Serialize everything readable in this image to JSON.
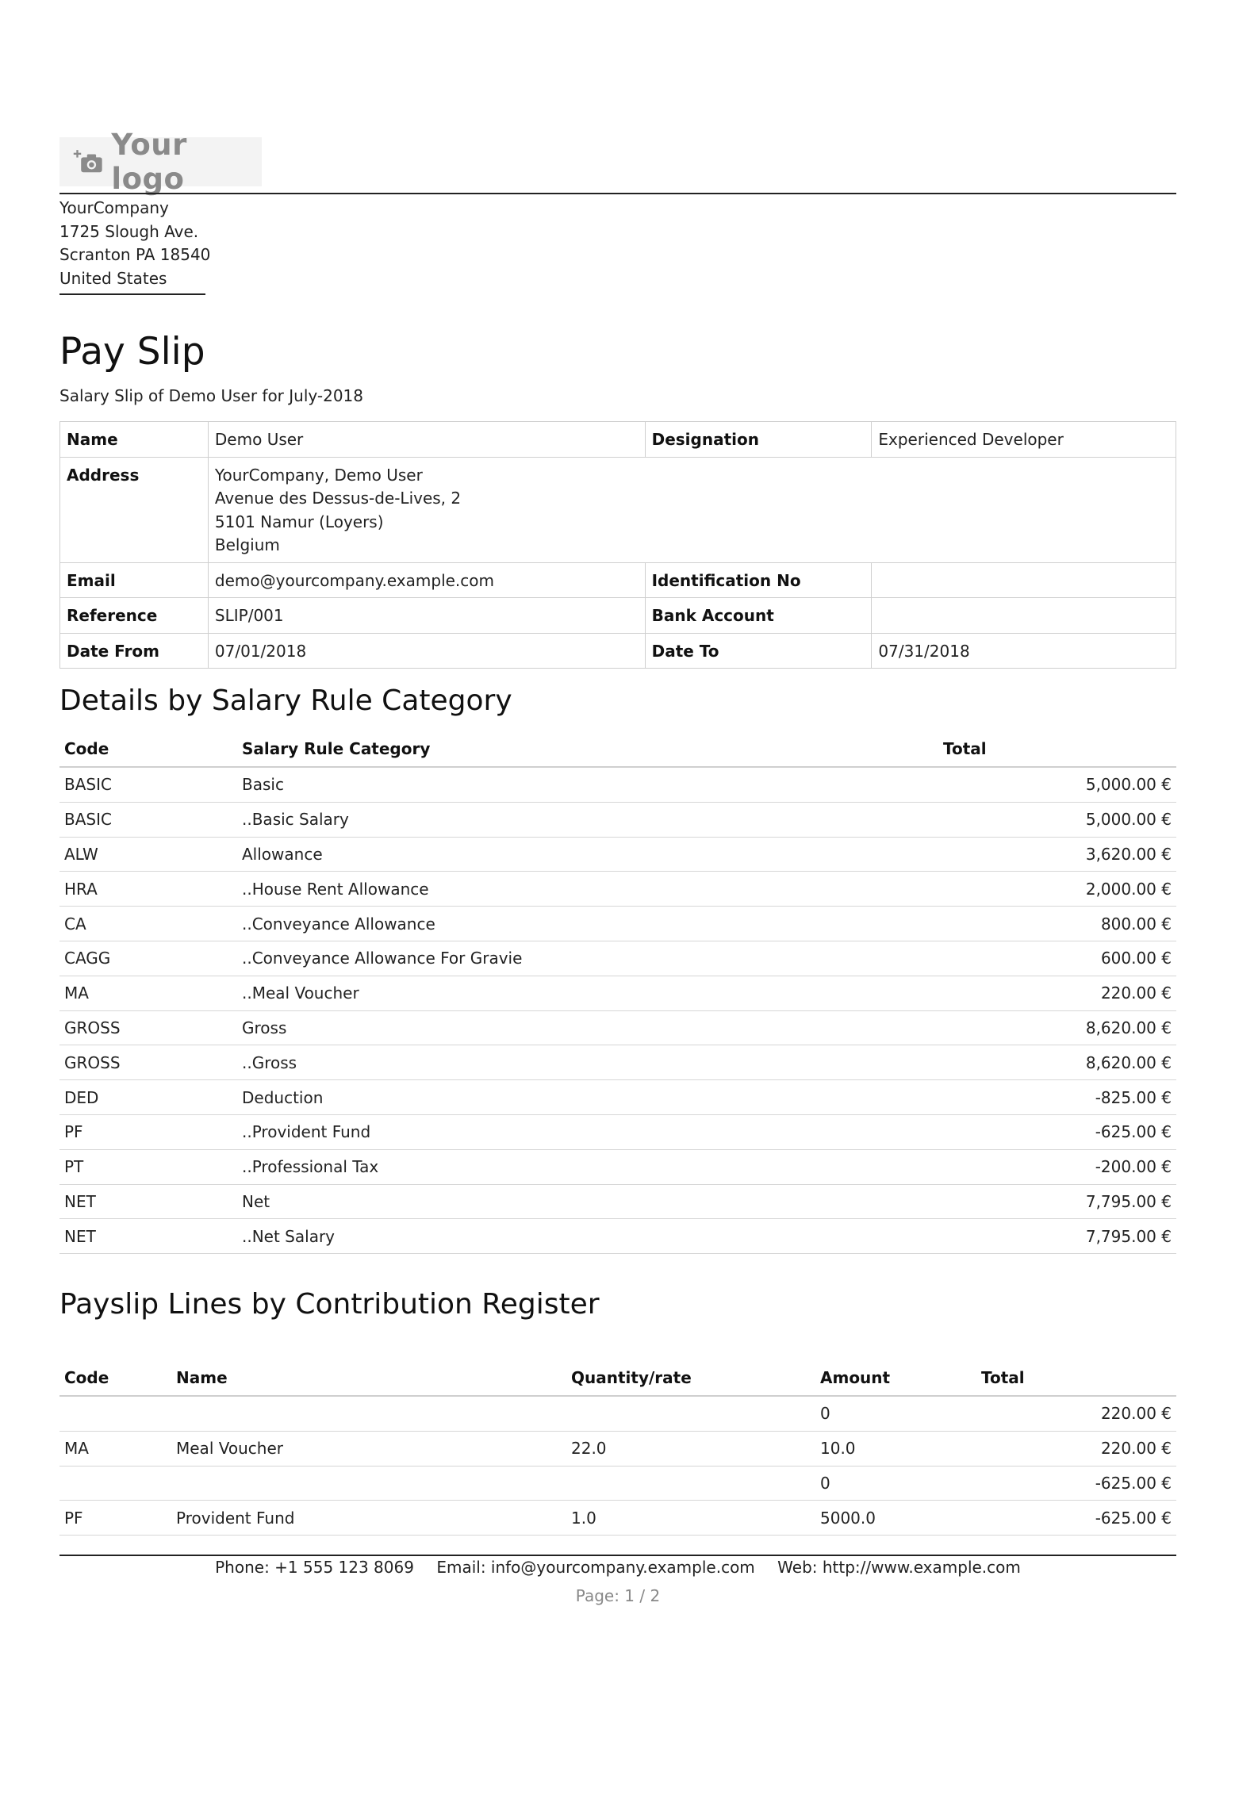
{
  "logo": {
    "text": "Your logo",
    "icon": "camera-plus-icon"
  },
  "company": {
    "name": "YourCompany",
    "street": "1725 Slough Ave.",
    "city": "Scranton PA 18540",
    "country": "United States"
  },
  "title": "Pay Slip",
  "subtitle": "Salary Slip of Demo User for July-2018",
  "info": {
    "name_label": "Name",
    "name": "Demo User",
    "designation_label": "Designation",
    "designation": "Experienced Developer",
    "address_label": "Address",
    "address": [
      "YourCompany, Demo User",
      "Avenue des Dessus-de-Lives, 2",
      "5101 Namur (Loyers)",
      "Belgium"
    ],
    "email_label": "Email",
    "email": "demo@yourcompany.example.com",
    "idno_label": "Identification No",
    "idno": "",
    "reference_label": "Reference",
    "reference": "SLIP/001",
    "bank_label": "Bank Account",
    "bank": "",
    "date_from_label": "Date From",
    "date_from": "07/01/2018",
    "date_to_label": "Date To",
    "date_to": "07/31/2018"
  },
  "categories": {
    "heading": "Details by Salary Rule Category",
    "headers": {
      "code": "Code",
      "category": "Salary Rule Category",
      "total": "Total"
    },
    "rows": [
      {
        "code": "BASIC",
        "category": "Basic",
        "total": "5,000.00 €"
      },
      {
        "code": "BASIC",
        "category": "..Basic Salary",
        "total": "5,000.00 €"
      },
      {
        "code": "ALW",
        "category": "Allowance",
        "total": "3,620.00 €"
      },
      {
        "code": "HRA",
        "category": "..House Rent Allowance",
        "total": "2,000.00 €"
      },
      {
        "code": "CA",
        "category": "..Conveyance Allowance",
        "total": "800.00 €"
      },
      {
        "code": "CAGG",
        "category": "..Conveyance Allowance For Gravie",
        "total": "600.00 €"
      },
      {
        "code": "MA",
        "category": "..Meal Voucher",
        "total": "220.00 €"
      },
      {
        "code": "GROSS",
        "category": "Gross",
        "total": "8,620.00 €"
      },
      {
        "code": "GROSS",
        "category": "..Gross",
        "total": "8,620.00 €"
      },
      {
        "code": "DED",
        "category": "Deduction",
        "total": "-825.00 €"
      },
      {
        "code": "PF",
        "category": "..Provident Fund",
        "total": "-625.00 €"
      },
      {
        "code": "PT",
        "category": "..Professional Tax",
        "total": "-200.00 €"
      },
      {
        "code": "NET",
        "category": "Net",
        "total": "7,795.00 €"
      },
      {
        "code": "NET",
        "category": "..Net Salary",
        "total": "7,795.00 €"
      }
    ]
  },
  "contributions": {
    "heading": "Payslip Lines by Contribution Register",
    "headers": {
      "code": "Code",
      "name": "Name",
      "qty": "Quantity/rate",
      "amount": "Amount",
      "total": "Total"
    },
    "rows": [
      {
        "code": "",
        "name": "",
        "qty": "",
        "amount": "0",
        "total": "220.00 €"
      },
      {
        "code": "MA",
        "name": "Meal Voucher",
        "qty": "22.0",
        "amount": "10.0",
        "total": "220.00 €"
      },
      {
        "code": "",
        "name": "",
        "qty": "",
        "amount": "0",
        "total": "-625.00 €"
      },
      {
        "code": "PF",
        "name": "Provident Fund",
        "qty": "1.0",
        "amount": "5000.0",
        "total": "-625.00 €"
      }
    ]
  },
  "footer": {
    "phone": "Phone: +1 555 123 8069",
    "email": "Email: info@yourcompany.example.com",
    "web": "Web: http://www.example.com",
    "page": "Page: 1 / 2"
  }
}
